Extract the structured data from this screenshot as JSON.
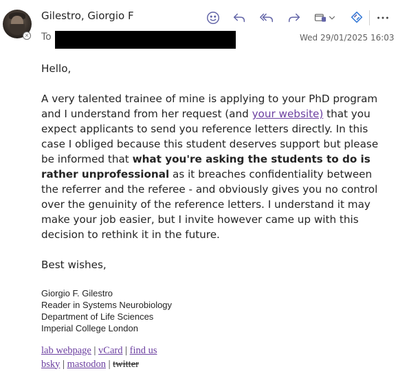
{
  "header": {
    "sender": "Gilestro, Giorgio F",
    "to_label": "To",
    "date": "Wed 29/01/2025 16:03"
  },
  "toolbar": {
    "icons": [
      "emoji-icon",
      "reply-icon",
      "reply-all-icon",
      "forward-icon",
      "apps-icon",
      "chevron-down-icon",
      "copilot-icon",
      "more-icon"
    ],
    "accent": "#6264a7"
  },
  "email": {
    "greeting": "Hello,",
    "para1_a": "A very talented trainee of mine is applying to your PhD program and I understand from her request (and ",
    "para1_link": "your website)",
    "para1_b": " that you expect applicants to send you reference letters directly. In this case I obliged because this student deserves support but please be informed that ",
    "para1_bold": "what you're asking the students to do is rather unprofessional",
    "para1_c": " as it breaches confidentiality between the referrer and the referee - and obviously gives you no control over the genuinity of the reference letters. I understand it may make your job easier, but I invite however came up with this decision to rethink it in the future.",
    "closing": "Best wishes,"
  },
  "signature": {
    "name": "Giorgio F. Gilestro",
    "title": "Reader in Systems Neurobiology",
    "department": "Department of Life Sciences",
    "institution": "Imperial College London"
  },
  "links": {
    "lab_webpage": "lab webpage",
    "vcard": "vCard",
    "find_us": "find us",
    "bsky": "bsky",
    "mastodon": "mastodon",
    "twitter": "twitter",
    "sep": "|"
  },
  "colors": {
    "link": "#6b3fa0",
    "text": "#242424",
    "muted": "#616161"
  }
}
